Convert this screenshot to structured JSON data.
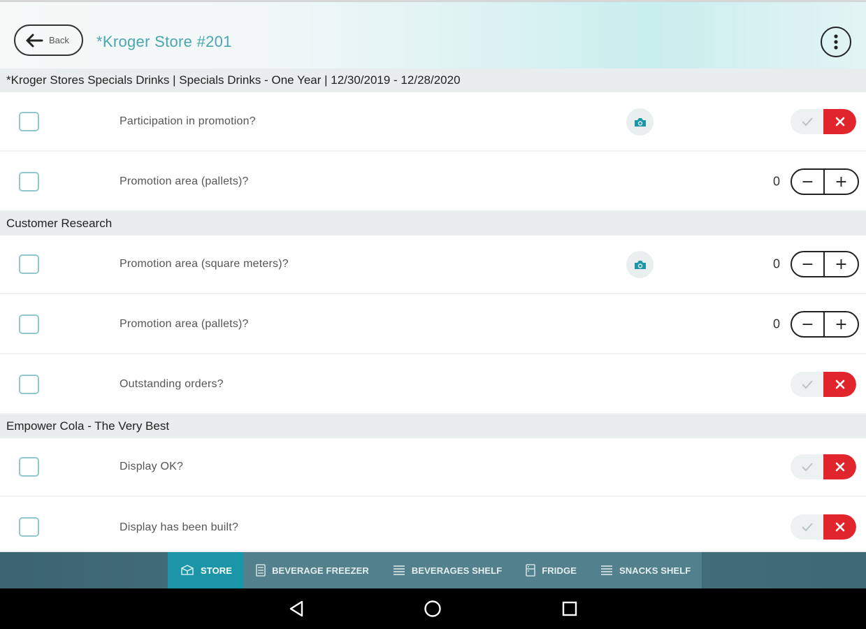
{
  "header": {
    "back_label": "Back",
    "store_title": "*Kroger Store #201",
    "menu_icon": "more-vertical-icon"
  },
  "sections": [
    {
      "title": "*Kroger Stores Specials Drinks | Specials Drinks - One Year | 12/30/2019 - 12/28/2020",
      "rows": [
        {
          "question": "Participation in promotion?",
          "control": "yes-no",
          "selected": "no",
          "camera": true
        },
        {
          "question": "Promotion area (pallets)?",
          "control": "stepper",
          "value": "0",
          "camera": false
        }
      ]
    },
    {
      "title": "Customer Research",
      "rows": [
        {
          "question": "Promotion area (square meters)?",
          "control": "stepper",
          "value": "0",
          "camera": true
        },
        {
          "question": "Promotion area (pallets)?",
          "control": "stepper",
          "value": "0",
          "camera": false
        },
        {
          "question": "Outstanding orders?",
          "control": "yes-no",
          "selected": "no",
          "camera": false
        }
      ]
    },
    {
      "title": "Empower Cola - The Very Best",
      "rows": [
        {
          "question": "Display OK?",
          "control": "yes-no",
          "selected": "no",
          "camera": false
        },
        {
          "question": "Display has been built?",
          "control": "yes-no",
          "selected": "no",
          "camera": false
        }
      ]
    }
  ],
  "stepper_symbols": {
    "minus": "−",
    "plus": "+"
  },
  "tabs": [
    {
      "label": "STORE",
      "icon": "store-icon",
      "active": true
    },
    {
      "label": "BEVERAGE FREEZER",
      "icon": "freezer-icon",
      "active": false
    },
    {
      "label": "BEVERAGES SHELF",
      "icon": "shelf-icon",
      "active": false
    },
    {
      "label": "FRIDGE",
      "icon": "fridge-icon",
      "active": false
    },
    {
      "label": "SNACKS SHELF",
      "icon": "shelf-icon",
      "active": false
    }
  ],
  "system_nav": [
    "back-triangle-icon",
    "home-circle-icon",
    "recents-square-icon"
  ],
  "colors": {
    "accent_teal": "#1b95a8",
    "title_teal": "#4aa6b0",
    "no_red": "#e0262c",
    "checkbox_border": "#8fc9cf"
  }
}
